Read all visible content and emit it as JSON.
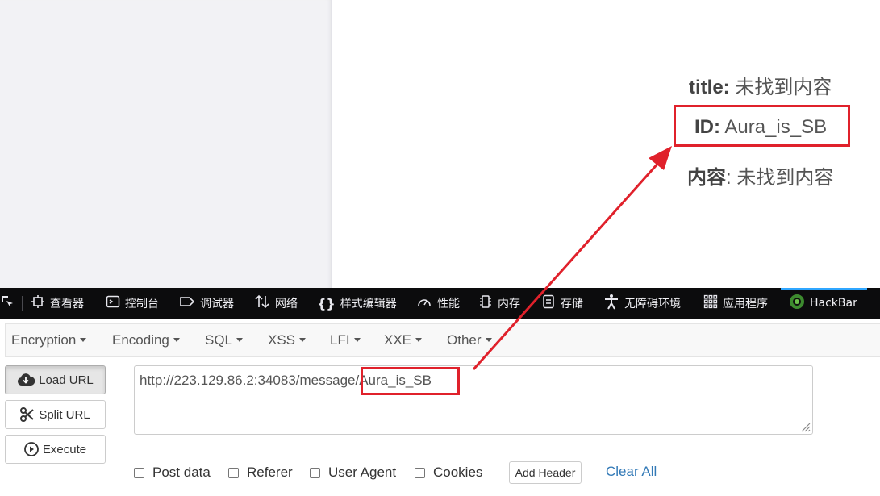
{
  "page": {
    "title_label": "title",
    "title_value": "未找到内容",
    "id_label": "ID",
    "id_value": "Aura_is_SB",
    "content_label": "内容",
    "content_value": "未找到内容"
  },
  "devtools": {
    "tabs": [
      {
        "label": "查看器",
        "icon": "inspector-icon"
      },
      {
        "label": "控制台",
        "icon": "console-icon"
      },
      {
        "label": "调试器",
        "icon": "debugger-icon"
      },
      {
        "label": "网络",
        "icon": "network-icon"
      },
      {
        "label": "样式编辑器",
        "icon": "style-editor-icon"
      },
      {
        "label": "性能",
        "icon": "performance-icon"
      },
      {
        "label": "内存",
        "icon": "memory-icon"
      },
      {
        "label": "存储",
        "icon": "storage-icon"
      },
      {
        "label": "无障碍环境",
        "icon": "accessibility-icon"
      },
      {
        "label": "应用程序",
        "icon": "application-icon"
      },
      {
        "label": "HackBar",
        "icon": "hackbar-icon",
        "active": true
      }
    ]
  },
  "hackbar": {
    "menus": [
      "Encryption",
      "Encoding",
      "SQL",
      "XSS",
      "LFI",
      "XXE",
      "Other"
    ],
    "load_url": "Load URL",
    "split_url": "Split URL",
    "execute": "Execute",
    "url_value": "http://223.129.86.2:34083/message/Aura_is_SB",
    "options": [
      "Post data",
      "Referer",
      "User Agent",
      "Cookies"
    ],
    "add_header": "Add Header",
    "clear_all": "Clear All"
  },
  "colors": {
    "annotation_red": "#e0212b",
    "devtools_bg": "#0c0c0d",
    "active_tab_accent": "#2fa6ff",
    "link_blue": "#337ab7"
  }
}
